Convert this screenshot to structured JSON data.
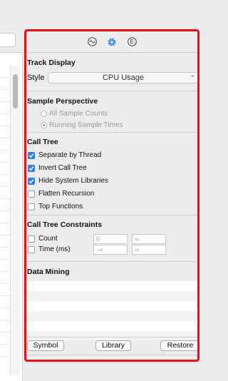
{
  "tabs": [
    {
      "icon": "waveform-icon"
    },
    {
      "icon": "gear-icon",
      "active": true
    },
    {
      "icon": "extended-detail-icon",
      "glyph": "E"
    }
  ],
  "track_display": {
    "title": "Track Display",
    "style_label": "Style",
    "style_value": "CPU Usage"
  },
  "sample_perspective": {
    "title": "Sample Perspective",
    "options": [
      {
        "label": "All Sample Counts",
        "selected": false
      },
      {
        "label": "Running Sample Times",
        "selected": true
      }
    ]
  },
  "call_tree": {
    "title": "Call Tree",
    "options": [
      {
        "label": "Separate by Thread",
        "checked": true
      },
      {
        "label": "Invert Call Tree",
        "checked": true
      },
      {
        "label": "Hide System Libraries",
        "checked": true
      },
      {
        "label": "Flatten Recursion",
        "checked": false
      },
      {
        "label": "Top Functions",
        "checked": false
      }
    ]
  },
  "constraints": {
    "title": "Call Tree Constraints",
    "count_label": "Count",
    "count_min": "0",
    "count_max": "∞",
    "time_label": "Time (ms)",
    "time_min": "-∞",
    "time_max": "∞"
  },
  "data_mining": {
    "title": "Data Mining",
    "buttons": {
      "symbol": "Symbol",
      "library": "Library",
      "restore": "Restore"
    }
  },
  "colors": {
    "highlight_border": "#e6121b",
    "accent": "#2d7cf6"
  }
}
